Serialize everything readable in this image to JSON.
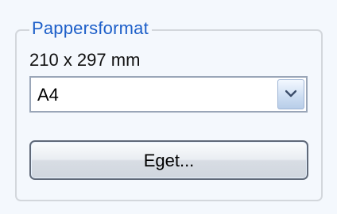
{
  "paper_format": {
    "group_title": "Pappersformat",
    "size_text": "210 x 297 mm",
    "dropdown": {
      "selected": "A4",
      "arrow_icon": "chevron-down-icon"
    },
    "custom_button_label": "Eget..."
  },
  "colors": {
    "group_title": "#1d5fc9",
    "background": "#f4f8fd"
  }
}
